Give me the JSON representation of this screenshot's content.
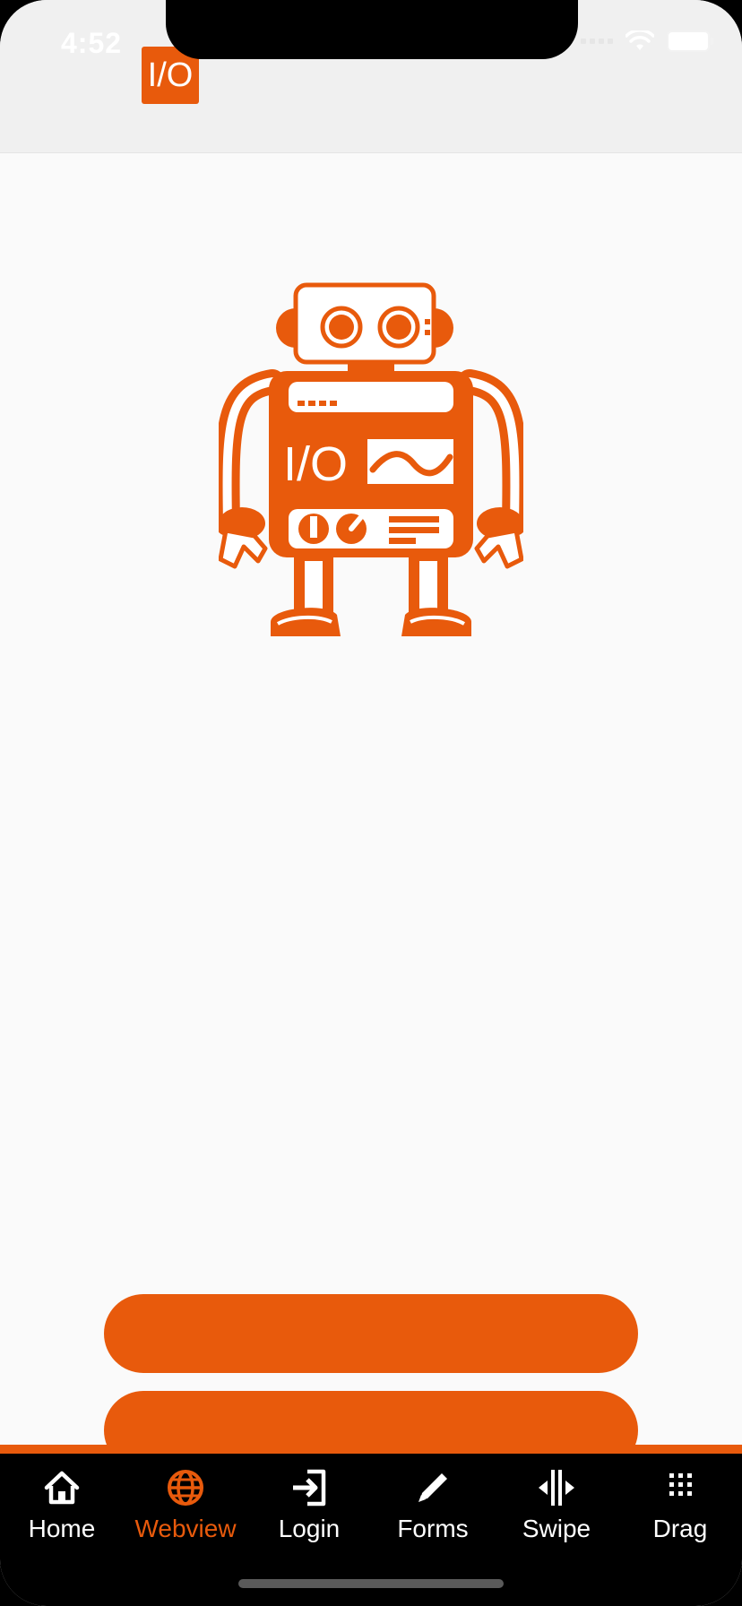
{
  "status_bar": {
    "time": "4:52"
  },
  "header": {
    "logo_text": "I/O"
  },
  "robot": {
    "panel_text": "I/O"
  },
  "tabs": [
    {
      "label": "Home",
      "icon": "home-icon",
      "active": false
    },
    {
      "label": "Webview",
      "icon": "globe-icon",
      "active": true
    },
    {
      "label": "Login",
      "icon": "login-icon",
      "active": false
    },
    {
      "label": "Forms",
      "icon": "pencil-icon",
      "active": false
    },
    {
      "label": "Swipe",
      "icon": "swipe-icon",
      "active": false
    },
    {
      "label": "Drag",
      "icon": "grid-icon",
      "active": false
    }
  ],
  "colors": {
    "accent": "#e85a0c",
    "tabbar": "#000000",
    "background": "#fafafa"
  }
}
